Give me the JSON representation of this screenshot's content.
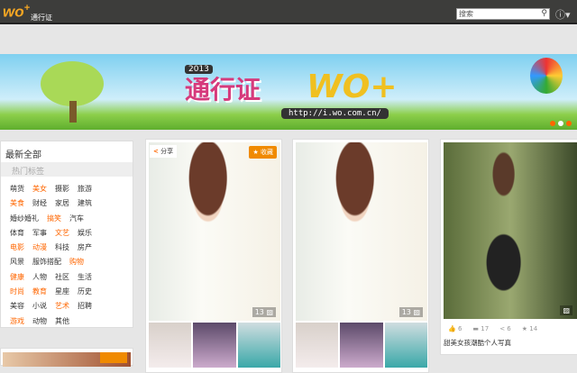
{
  "header": {
    "logo": "wo",
    "logo_plus": "+",
    "logo_text": "通行证",
    "search_placeholder": "搜索",
    "search_icon": "search-icon",
    "info_icon": "info-icon"
  },
  "banner": {
    "year": "2013",
    "title": "通行证",
    "brand": "WO+",
    "url": "http://i.wo.com.cn/"
  },
  "sidebar": {
    "title": "最新全部",
    "hot_label": "热门标签",
    "tags": [
      {
        "label": "萌货",
        "hl": false
      },
      {
        "label": "美女",
        "hl": true
      },
      {
        "label": "摄影",
        "hl": false
      },
      {
        "label": "旅游",
        "hl": false
      },
      {
        "label": "美食",
        "hl": true
      },
      {
        "label": "财经",
        "hl": false
      },
      {
        "label": "家居",
        "hl": false
      },
      {
        "label": "建筑",
        "hl": false
      },
      {
        "label": "婚纱婚礼",
        "hl": false
      },
      {
        "label": "搞笑",
        "hl": true
      },
      {
        "label": "汽车",
        "hl": false
      },
      {
        "label": "体育",
        "hl": false
      },
      {
        "label": "军事",
        "hl": false
      },
      {
        "label": "文艺",
        "hl": true
      },
      {
        "label": "娱乐",
        "hl": false
      },
      {
        "label": "电影",
        "hl": true
      },
      {
        "label": "动漫",
        "hl": true
      },
      {
        "label": "科技",
        "hl": false
      },
      {
        "label": "房产",
        "hl": false
      },
      {
        "label": "风景",
        "hl": false
      },
      {
        "label": "服饰搭配",
        "hl": false
      },
      {
        "label": "购物",
        "hl": true
      },
      {
        "label": "健康",
        "hl": true
      },
      {
        "label": "人物",
        "hl": false
      },
      {
        "label": "社区",
        "hl": false
      },
      {
        "label": "生活",
        "hl": false
      },
      {
        "label": "时尚",
        "hl": true
      },
      {
        "label": "教育",
        "hl": true
      },
      {
        "label": "星座",
        "hl": false
      },
      {
        "label": "历史",
        "hl": false
      },
      {
        "label": "美容",
        "hl": false
      },
      {
        "label": "小说",
        "hl": false
      },
      {
        "label": "艺术",
        "hl": true
      },
      {
        "label": "招聘",
        "hl": false
      },
      {
        "label": "游戏",
        "hl": true
      },
      {
        "label": "动物",
        "hl": false
      },
      {
        "label": "其他",
        "hl": false
      }
    ]
  },
  "cards": [
    {
      "share": "分享",
      "fav": "收藏",
      "count": "13"
    },
    {
      "count": "13"
    },
    {
      "likes": "6",
      "comments": "17",
      "shares": "6",
      "favs": "14",
      "caption": "甜美女孩潮酷个人写真"
    }
  ],
  "colors": {
    "accent": "#f08a00",
    "header": "#3d3d3b"
  }
}
